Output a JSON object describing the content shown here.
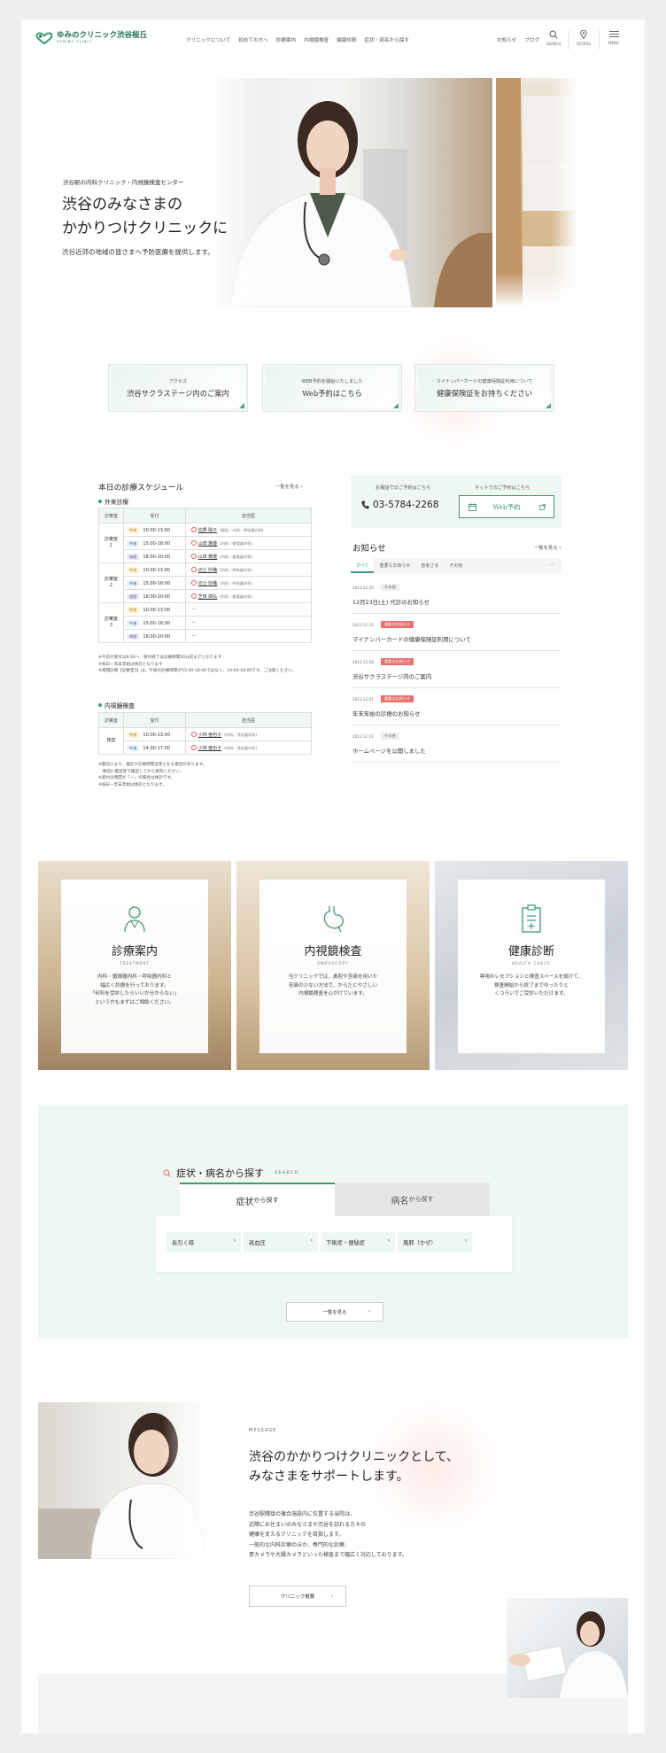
{
  "header": {
    "logo_text": "ゆみのクリニック渋谷桜丘",
    "logo_sub": "YUMINO CLINIC",
    "nav": [
      "クリニックについて",
      "初めての方へ",
      "診療案内",
      "内視鏡検査",
      "健康診断",
      "症状・病名から探す"
    ],
    "util": [
      "お知らせ",
      "ブログ"
    ],
    "icons": [
      {
        "name": "search-icon",
        "label": "SEARCH"
      },
      {
        "name": "map-pin-icon",
        "label": "ACCESS"
      },
      {
        "name": "hamburger-icon",
        "label": "MENU"
      }
    ]
  },
  "hero": {
    "eyebrow": "渋谷駅の内科クリニック・内視鏡検査センター",
    "title_line1": "渋谷のみなさまの",
    "title_line2": "かかりつけクリニックに",
    "lead": "渋谷近郊の地域の皆さまへ予防医療を提供します。",
    "sign_text": "ゆみのクリニック渋谷桜丘"
  },
  "banners": [
    {
      "small": "アクセス",
      "main": "渋谷サクラステージ内のご案内"
    },
    {
      "small": "WEB予約を開始いたしました",
      "main": "Web予約はこちら"
    },
    {
      "small": "マイナンバーカードの健康保険証利用について",
      "main": "健康保険証をお持ちください"
    }
  ],
  "schedule": {
    "title": "本日の診療スケジュール",
    "more": "一覧を見る",
    "outpatient_heading": "外来診療",
    "columns": [
      "診察室",
      "受付",
      "担当医"
    ],
    "rooms": [
      {
        "room": "診察室\n1",
        "rows": [
          {
            "tag": "午前",
            "cls": "am",
            "time": "10:00-13:00",
            "status": "○",
            "doctor": "佐野 陽子",
            "note": "(総診／内科／呼吸器内科)"
          },
          {
            "tag": "午後",
            "cls": "pm",
            "time": "15:00-18:00",
            "status": "○",
            "doctor": "山田 雅雄",
            "note": "(内科／循環器内科)"
          },
          {
            "tag": "夜間",
            "cls": "ev",
            "time": "18:00-20:00",
            "status": "○",
            "doctor": "山田 雅雄",
            "note": "(内科／循環器内科)"
          }
        ]
      },
      {
        "room": "診察室\n2",
        "rows": [
          {
            "tag": "午前",
            "cls": "am",
            "time": "10:00-13:00",
            "status": "○",
            "doctor": "切士 妙織",
            "note": "(内科／呼吸器内科)"
          },
          {
            "tag": "午後",
            "cls": "pm",
            "time": "15:00-18:00",
            "status": "○",
            "doctor": "切士 妙織",
            "note": "(内科／呼吸器内科)"
          },
          {
            "tag": "夜間",
            "cls": "ev",
            "time": "18:00-20:00",
            "status": "○",
            "doctor": "芝田 康弘",
            "note": "(内科／循環器内科)"
          }
        ]
      },
      {
        "room": "診察室\n3",
        "rows": [
          {
            "tag": "午前",
            "cls": "am",
            "time": "10:00-13:00",
            "status": "ー",
            "doctor": "",
            "note": ""
          },
          {
            "tag": "午後",
            "cls": "pm",
            "time": "15:00-18:00",
            "status": "ー",
            "doctor": "",
            "note": ""
          },
          {
            "tag": "夜間",
            "cls": "ev",
            "time": "18:00-20:00",
            "status": "ー",
            "doctor": "",
            "note": ""
          }
        ]
      }
    ],
    "notes1": [
      "※午前の受付は9:30〜、受付終了は診療時間30分前までとなります",
      "※祝日・年末年始は休診となります",
      "※夜間診療【診察室3】は、午後の診療時間が15:00-18:00ではなく、16:00-18:00です。ご注意ください。"
    ],
    "endo_heading": "内視鏡検査",
    "endo_rows": [
      {
        "tag": "午前",
        "cls": "am",
        "time": "10:00-13:00",
        "status": "○",
        "doctor": "小林 亜也子",
        "note": "(内科／消化器内科)"
      },
      {
        "tag": "午後",
        "cls": "pm",
        "time": "14:00-17:00",
        "status": "○",
        "doctor": "小林 亜也子",
        "note": "(内科／消化器内科)"
      }
    ],
    "endo_room": "検査",
    "notes2": [
      "※都合により、検診や診療時間変更となる場合があります。",
      "　事前に電話等で確認してから来院ください。",
      "※受付の時間が「ー」の場合は休診です。",
      "※祝日・年末年始は休診となります。"
    ]
  },
  "reservation": {
    "tel_label": "お電話でのご予約はこちら",
    "tel": "03-5784-2268",
    "web_label": "ネットでのご予約はこちら",
    "web_btn": "Web予約"
  },
  "news": {
    "title": "お知らせ",
    "more": "一覧を見る",
    "tabs": [
      "すべて",
      "重要なお知らせ",
      "患者さま",
      "その他"
    ],
    "items": [
      {
        "date": "2023.12.20",
        "tag": "その他",
        "tagcls": "g",
        "text": "12月23日(土) 代診のお知らせ"
      },
      {
        "date": "2023.12.20",
        "tag": "重要なお知らせ",
        "tagcls": "r",
        "text": "マイナンバーカードの健康保険証利用について"
      },
      {
        "date": "2023.12.08",
        "tag": "重要なお知らせ",
        "tagcls": "r",
        "text": "渋谷サクラステージ内のご案内"
      },
      {
        "date": "2023.12.01",
        "tag": "重要なお知らせ",
        "tagcls": "r",
        "text": "年末年始の診療のお知らせ"
      },
      {
        "date": "2023.12.01",
        "tag": "その他",
        "tagcls": "g",
        "text": "ホームページを公開しました"
      }
    ]
  },
  "services": [
    {
      "icon": "doctor-icon",
      "jp": "診療案内",
      "en": "TREATMENT",
      "desc": [
        "内科・循環器内科・呼吸器内科と",
        "幅広く診療を行っております。",
        "「何科を受診したらいいか分からない」",
        "という方もまずはご相談ください。"
      ]
    },
    {
      "icon": "stomach-icon",
      "jp": "内視鏡検査",
      "en": "ENDOSCOPY",
      "desc": [
        "当クリニックでは、鼻腔や苦痛を用いた",
        "苦痛の少ない方法で、からだにやさしい",
        "内視鏡検査を心がけています。"
      ]
    },
    {
      "icon": "clipboard-icon",
      "jp": "健康診断",
      "en": "HEALTH CHECK",
      "desc": [
        "専用のレセプションと検査スペースを設けて、",
        "検査開始から終了までゆったりと",
        "くつろいでご受診いただけます。"
      ]
    }
  ],
  "search": {
    "title": "症状・病名から探す",
    "title_en": "SEARCH",
    "tab1_main": "症状",
    "tab1_suffix": "から探す",
    "tab2_main": "病名",
    "tab2_suffix": "から探す",
    "chips": [
      "長引く咳",
      "高血圧",
      "下痢症・便秘症",
      "風邪（かぜ）"
    ],
    "more": "一覧を見る"
  },
  "message": {
    "label": "MESSAGE",
    "title_line1": "渋谷のかかりつけクリニックとして、",
    "title_line2": "みなさまをサポートします。",
    "body": [
      "渋谷駅隣接の複合施設内に位置する当院は、",
      "近隣にお住まいのみなさまや渋谷を訪れる方々の",
      "健康を支えるクリニックを目指します。",
      "一般的な内科診療のほか、専門的な診療、",
      "胃カメラや大腸カメラといった検査まで幅広く対応しております。"
    ],
    "button": "クリニック概要"
  },
  "colors": {
    "accent": "#3f9a72",
    "mint": "#eef7f2",
    "red": "#e87070"
  }
}
